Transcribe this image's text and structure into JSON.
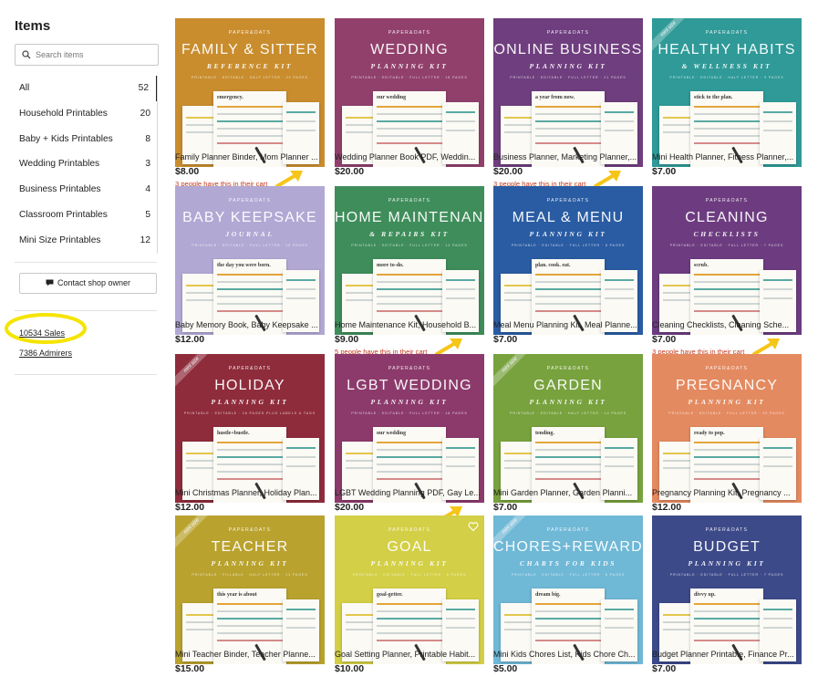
{
  "sidebar": {
    "title": "Items",
    "search_placeholder": "Search items",
    "categories": [
      {
        "label": "All",
        "count": "52"
      },
      {
        "label": "Household Printables",
        "count": "20"
      },
      {
        "label": "Baby + Kids Printables",
        "count": "8"
      },
      {
        "label": "Wedding Printables",
        "count": "3"
      },
      {
        "label": "Business Printables",
        "count": "4"
      },
      {
        "label": "Classroom Printables",
        "count": "5"
      },
      {
        "label": "Mini Size Printables",
        "count": "12"
      }
    ],
    "contact_label": "Contact shop owner",
    "sales": "10534 Sales",
    "admirers": "7386 Admirers"
  },
  "products": [
    {
      "brand": "PAPER&OATS",
      "title": "FAMILY & SITTER",
      "subtitle": "REFERENCE KIT",
      "specs": "PRINTABLE · EDITABLE · HALF LETTER · 22 PAGES",
      "sheet_text": "emergency.",
      "color": "#c98d2e",
      "desc": "Family Planner Binder, Mom Planner ...",
      "price": "$8.00",
      "cart": "3 people have this in their cart",
      "mini": ""
    },
    {
      "brand": "PAPER&OATS",
      "title": "WEDDING",
      "subtitle": "PLANNING KIT",
      "specs": "PRINTABLE · EDITABLE · FULL LETTER · 18 PAGES",
      "sheet_text": "our wedding",
      "color": "#91406c",
      "desc": "Wedding Planner Book PDF, Weddin...",
      "price": "$20.00",
      "cart": "",
      "mini": ""
    },
    {
      "brand": "PAPER&OATS",
      "title": "ONLINE BUSINESS",
      "subtitle": "PLANNING KIT",
      "specs": "PRINTABLE · EDITABLE · FULL LETTER · 21 PAGES",
      "sheet_text": "a year from now.",
      "color": "#6e3e7e",
      "desc": "Business Planner, Marketing Planner,...",
      "price": "$20.00",
      "cart": "3 people have this in their cart",
      "mini": ""
    },
    {
      "brand": "PAPER&OATS",
      "title": "HEALTHY HABITS",
      "subtitle": "& WELLNESS KIT",
      "specs": "PRINTABLE · EDITABLE · HALF LETTER · 9 PAGES",
      "sheet_text": "stick to the plan.",
      "color": "#2f9a98",
      "desc": "Mini Health Planner, Fitness Planner,...",
      "price": "$7.00",
      "cart": "",
      "mini": "mini size"
    },
    {
      "brand": "PAPER&OATS",
      "title": "BABY KEEPSAKE",
      "subtitle": "JOURNAL",
      "specs": "PRINTABLE · EDITABLE · FULL LETTER · 16 PAGES",
      "sheet_text": "the day you were born.",
      "color": "#b2a8d4",
      "desc": "Baby Memory Book, Baby Keepsake ...",
      "price": "$12.00",
      "cart": "",
      "mini": ""
    },
    {
      "brand": "PAPER&OATS",
      "title": "HOME MAINTENANCE",
      "subtitle": "& REPAIRS KIT",
      "specs": "PRINTABLE · EDITABLE · FULL LETTER · 13 PAGES",
      "sheet_text": "more to-do.",
      "color": "#3f8d5b",
      "desc": "Home Maintenance Kit, Household B...",
      "price": "$9.00",
      "cart": "5 people have this in their cart",
      "mini": ""
    },
    {
      "brand": "PAPER&OATS",
      "title": "MEAL & MENU",
      "subtitle": "PLANNING KIT",
      "specs": "PRINTABLE · EDITABLE · FULL LETTER · 8 PAGES",
      "sheet_text": "plan. cook. eat.",
      "color": "#2a5ca3",
      "desc": "Meal Menu Planning Kit, Meal Planne...",
      "price": "$7.00",
      "cart": "",
      "mini": ""
    },
    {
      "brand": "PAPER&OATS",
      "title": "CLEANING",
      "subtitle": "CHECKLISTS",
      "specs": "PRINTABLE · EDITABLE · FULL LETTER · 7 PAGES",
      "sheet_text": "scrub.",
      "color": "#6d3c80",
      "desc": "Cleaning Checklists, Cleaning Sche...",
      "price": "$7.00",
      "cart": "3 people have this in their cart",
      "mini": ""
    },
    {
      "brand": "PAPER&OATS",
      "title": "HOLIDAY",
      "subtitle": "PLANNING KIT",
      "specs": "PRINTABLE · EDITABLE · 16 PAGES PLUS LABELS & TAGS",
      "sheet_text": "hustle+bustle.",
      "color": "#8f2c3c",
      "desc": "Mini Christmas Planner, Holiday Plan...",
      "price": "$12.00",
      "cart": "",
      "mini": "mini size"
    },
    {
      "brand": "PAPER&OATS",
      "title": "LGBT WEDDING",
      "subtitle": "PLANNING KIT",
      "specs": "PRINTABLE · EDITABLE · FULL LETTER · 18 PAGES",
      "sheet_text": "our wedding",
      "color": "#8c3a6c",
      "desc": "LGBT Wedding Planning PDF, Gay Le...",
      "price": "$20.00",
      "cart": "3 people have this in their cart",
      "mini": ""
    },
    {
      "brand": "PAPER&OATS",
      "title": "GARDEN",
      "subtitle": "PLANNING KIT",
      "specs": "PRINTABLE · EDITABLE · HALF LETTER · 14 PAGES",
      "sheet_text": "tending.",
      "color": "#78a23e",
      "desc": "Mini Garden Planner, Garden Planni...",
      "price": "$7.00",
      "cart": "",
      "mini": "mini size"
    },
    {
      "brand": "PAPER&OATS",
      "title": "PREGNANCY",
      "subtitle": "PLANNING KIT",
      "specs": "PRINTABLE · EDITABLE · FULL LETTER · 20 PAGES",
      "sheet_text": "ready to pop.",
      "color": "#e48a60",
      "desc": "Pregnancy Planning Kit, Pregnancy ...",
      "price": "$12.00",
      "cart": "",
      "mini": ""
    },
    {
      "brand": "PAPER&OATS",
      "title": "TEACHER",
      "subtitle": "PLANNING KIT",
      "specs": "PRINTABLE · FILLABLE · HALF LETTER · 13 PAGES",
      "sheet_text": "this year is about",
      "color": "#b9a22e",
      "desc": "Mini Teacher Binder, Teacher Planne...",
      "price": "$15.00",
      "cart": "",
      "mini": "mini size"
    },
    {
      "brand": "PAPER&OATS",
      "title": "GOAL",
      "subtitle": "PLANNING KIT",
      "specs": "PRINTABLE · EDITABLE · FULL LETTER · 6 PAGES",
      "sheet_text": "goal-getter.",
      "color": "#d3cf46",
      "desc": "Goal Setting Planner, Printable Habit...",
      "price": "$10.00",
      "cart": "",
      "mini": ""
    },
    {
      "brand": "PAPER&OATS",
      "title": "CHORES+REWARDS",
      "subtitle": "CHARTS FOR KIDS",
      "specs": "PRINTABLE · EDITABLE · FULL LETTER · 6 PAGES",
      "sheet_text": "dream big.",
      "color": "#6fb8d6",
      "desc": "Mini Kids Chores List, Kids Chore Ch...",
      "price": "$5.00",
      "cart": "",
      "mini": "mini size"
    },
    {
      "brand": "PAPER&OATS",
      "title": "BUDGET",
      "subtitle": "PLANNING KIT",
      "specs": "PRINTABLE · EDITABLE · FULL LETTER · 7 PAGES",
      "sheet_text": "divvy up.",
      "color": "#3d4a8a",
      "desc": "Budget Planner Printable, Finance Pr...",
      "price": "$7.00",
      "cart": "",
      "mini": ""
    }
  ],
  "colors": {
    "cart_text": "#c13a1f",
    "arrow": "#f5c518",
    "annotation_circle": "#f5e400"
  }
}
